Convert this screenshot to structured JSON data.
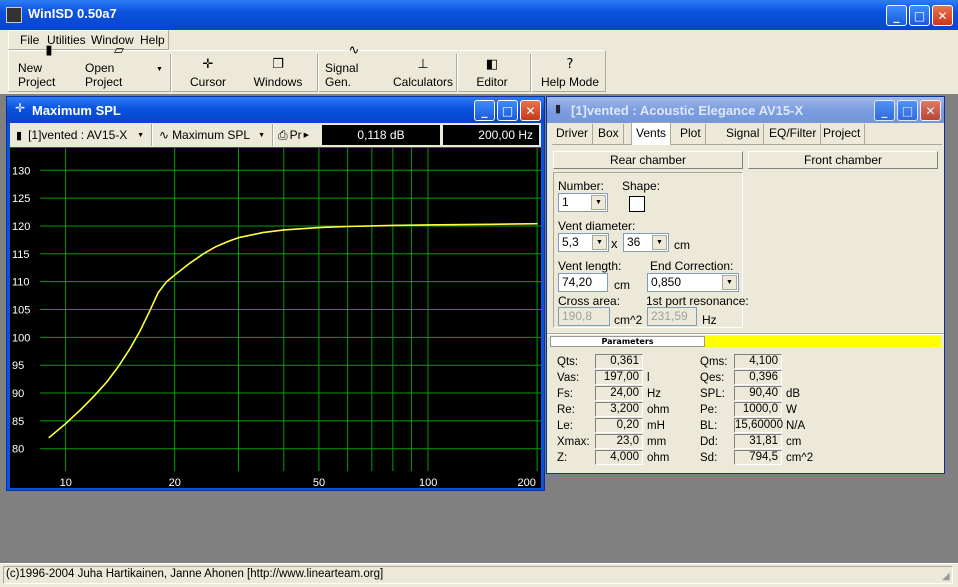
{
  "app": {
    "title": "WinISD 0.50a7"
  },
  "menu": {
    "file": "File",
    "utilities": "Utilities",
    "window": "Window",
    "help": "Help"
  },
  "toolbar": {
    "new_project": "New Project",
    "open_project": "Open Project",
    "cursor": "Cursor",
    "windows": "Windows",
    "signal_gen": "Signal Gen.",
    "calculators": "Calculators",
    "editor": "Editor",
    "help_mode": "Help Mode"
  },
  "spl_window": {
    "title": "Maximum SPL",
    "project_select": "[1]vented : AV15-X",
    "plot_select": "Maximum SPL",
    "print_label": "Pr",
    "db_readout": "0,118 dB",
    "hz_readout": "200,00 Hz"
  },
  "chart_data": {
    "type": "line",
    "title": "",
    "xlabel": "",
    "ylabel": "",
    "xscale": "log",
    "xlim": [
      8.5,
      205
    ],
    "ylim": [
      76,
      134
    ],
    "x_ticks": [
      "10",
      "20",
      "50",
      "100",
      "200"
    ],
    "y_ticks": [
      "80",
      "85",
      "90",
      "95",
      "100",
      "105",
      "110",
      "115",
      "120",
      "125",
      "130"
    ],
    "grid": true,
    "series": [
      {
        "color": "#ffff40",
        "x": [
          9,
          10,
          11,
          12,
          13,
          14,
          15,
          16,
          17,
          18,
          19,
          20,
          22,
          24,
          26,
          28,
          30,
          35,
          40,
          50,
          60,
          80,
          100,
          150,
          200
        ],
        "y": [
          82,
          84.5,
          87,
          89.5,
          92,
          94.8,
          97.8,
          101,
          104.5,
          108,
          110,
          111.2,
          113.3,
          115,
          116.3,
          117.2,
          117.9,
          118.8,
          119.3,
          119.7,
          119.9,
          120.1,
          120.2,
          120.3,
          120.4
        ]
      }
    ]
  },
  "project_window": {
    "title": "[1]vented : Acoustic Elegance AV15-X",
    "tabs": [
      "Driver",
      "Box",
      "Vents",
      "Plot",
      "Signal",
      "EQ/Filter",
      "Project"
    ],
    "active_tab": "Vents",
    "rear_chamber": "Rear chamber",
    "front_chamber": "Front chamber",
    "number_label": "Number:",
    "number_value": "1",
    "shape_label": "Shape:",
    "vent_diameter_label": "Vent diameter:",
    "vent_dia_a": "5,3",
    "times": "x",
    "vent_dia_b": "36",
    "cm1": "cm",
    "vent_length_label": "Vent length:",
    "vent_length_value": "74,20",
    "cm2": "cm",
    "end_correction_label": "End Correction:",
    "end_correction_value": "0,850",
    "cross_area_label": "Cross area:",
    "cross_area_value": "190,8",
    "cm2_unit": "cm^2",
    "port_res_label": "1st port resonance:",
    "port_res_value": "231,59",
    "hz_unit": "Hz",
    "parameters_header": "Parameters",
    "params_left": [
      {
        "label": "Qts:",
        "value": "0,361",
        "unit": ""
      },
      {
        "label": "Vas:",
        "value": "197,00",
        "unit": "l"
      },
      {
        "label": "Fs:",
        "value": "24,00",
        "unit": "Hz"
      },
      {
        "label": "Re:",
        "value": "3,200",
        "unit": "ohm"
      },
      {
        "label": "Le:",
        "value": "0,20",
        "unit": "mH"
      },
      {
        "label": "Xmax:",
        "value": "23,0",
        "unit": "mm"
      },
      {
        "label": "Z:",
        "value": "4,000",
        "unit": "ohm"
      }
    ],
    "params_right": [
      {
        "label": "Qms:",
        "value": "4,100",
        "unit": ""
      },
      {
        "label": "Qes:",
        "value": "0,396",
        "unit": ""
      },
      {
        "label": "SPL:",
        "value": "90,40",
        "unit": "dB"
      },
      {
        "label": "Pe:",
        "value": "1000,0",
        "unit": "W"
      },
      {
        "label": "BL:",
        "value": "15,60000",
        "unit": "N/A"
      },
      {
        "label": "Dd:",
        "value": "31,81",
        "unit": "cm"
      },
      {
        "label": "Sd:",
        "value": "794,5",
        "unit": "cm^2"
      }
    ]
  },
  "status": {
    "text": "(c)1996-2004 Juha Hartikainen, Janne Ahonen [http://www.linearteam.org]"
  },
  "colors": {
    "titlebar": "#0a53e0",
    "plot_bg": "#000000",
    "grid": "#00a000",
    "curve": "#ffff40",
    "param_bar": "#ffff00"
  }
}
